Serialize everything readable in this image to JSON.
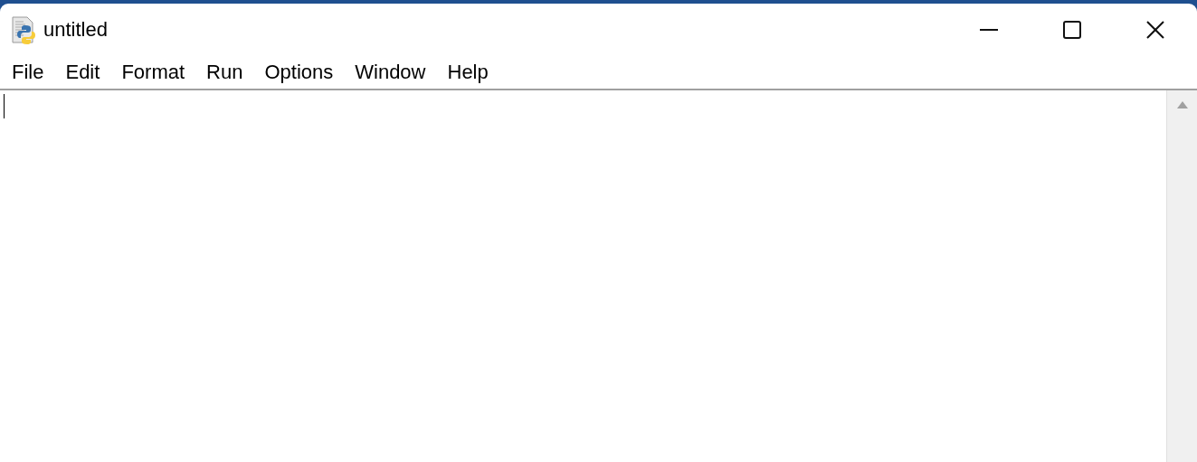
{
  "window": {
    "title": "untitled"
  },
  "menu": [
    {
      "label": "File"
    },
    {
      "label": "Edit"
    },
    {
      "label": "Format"
    },
    {
      "label": "Run"
    },
    {
      "label": "Options"
    },
    {
      "label": "Window"
    },
    {
      "label": "Help"
    }
  ]
}
